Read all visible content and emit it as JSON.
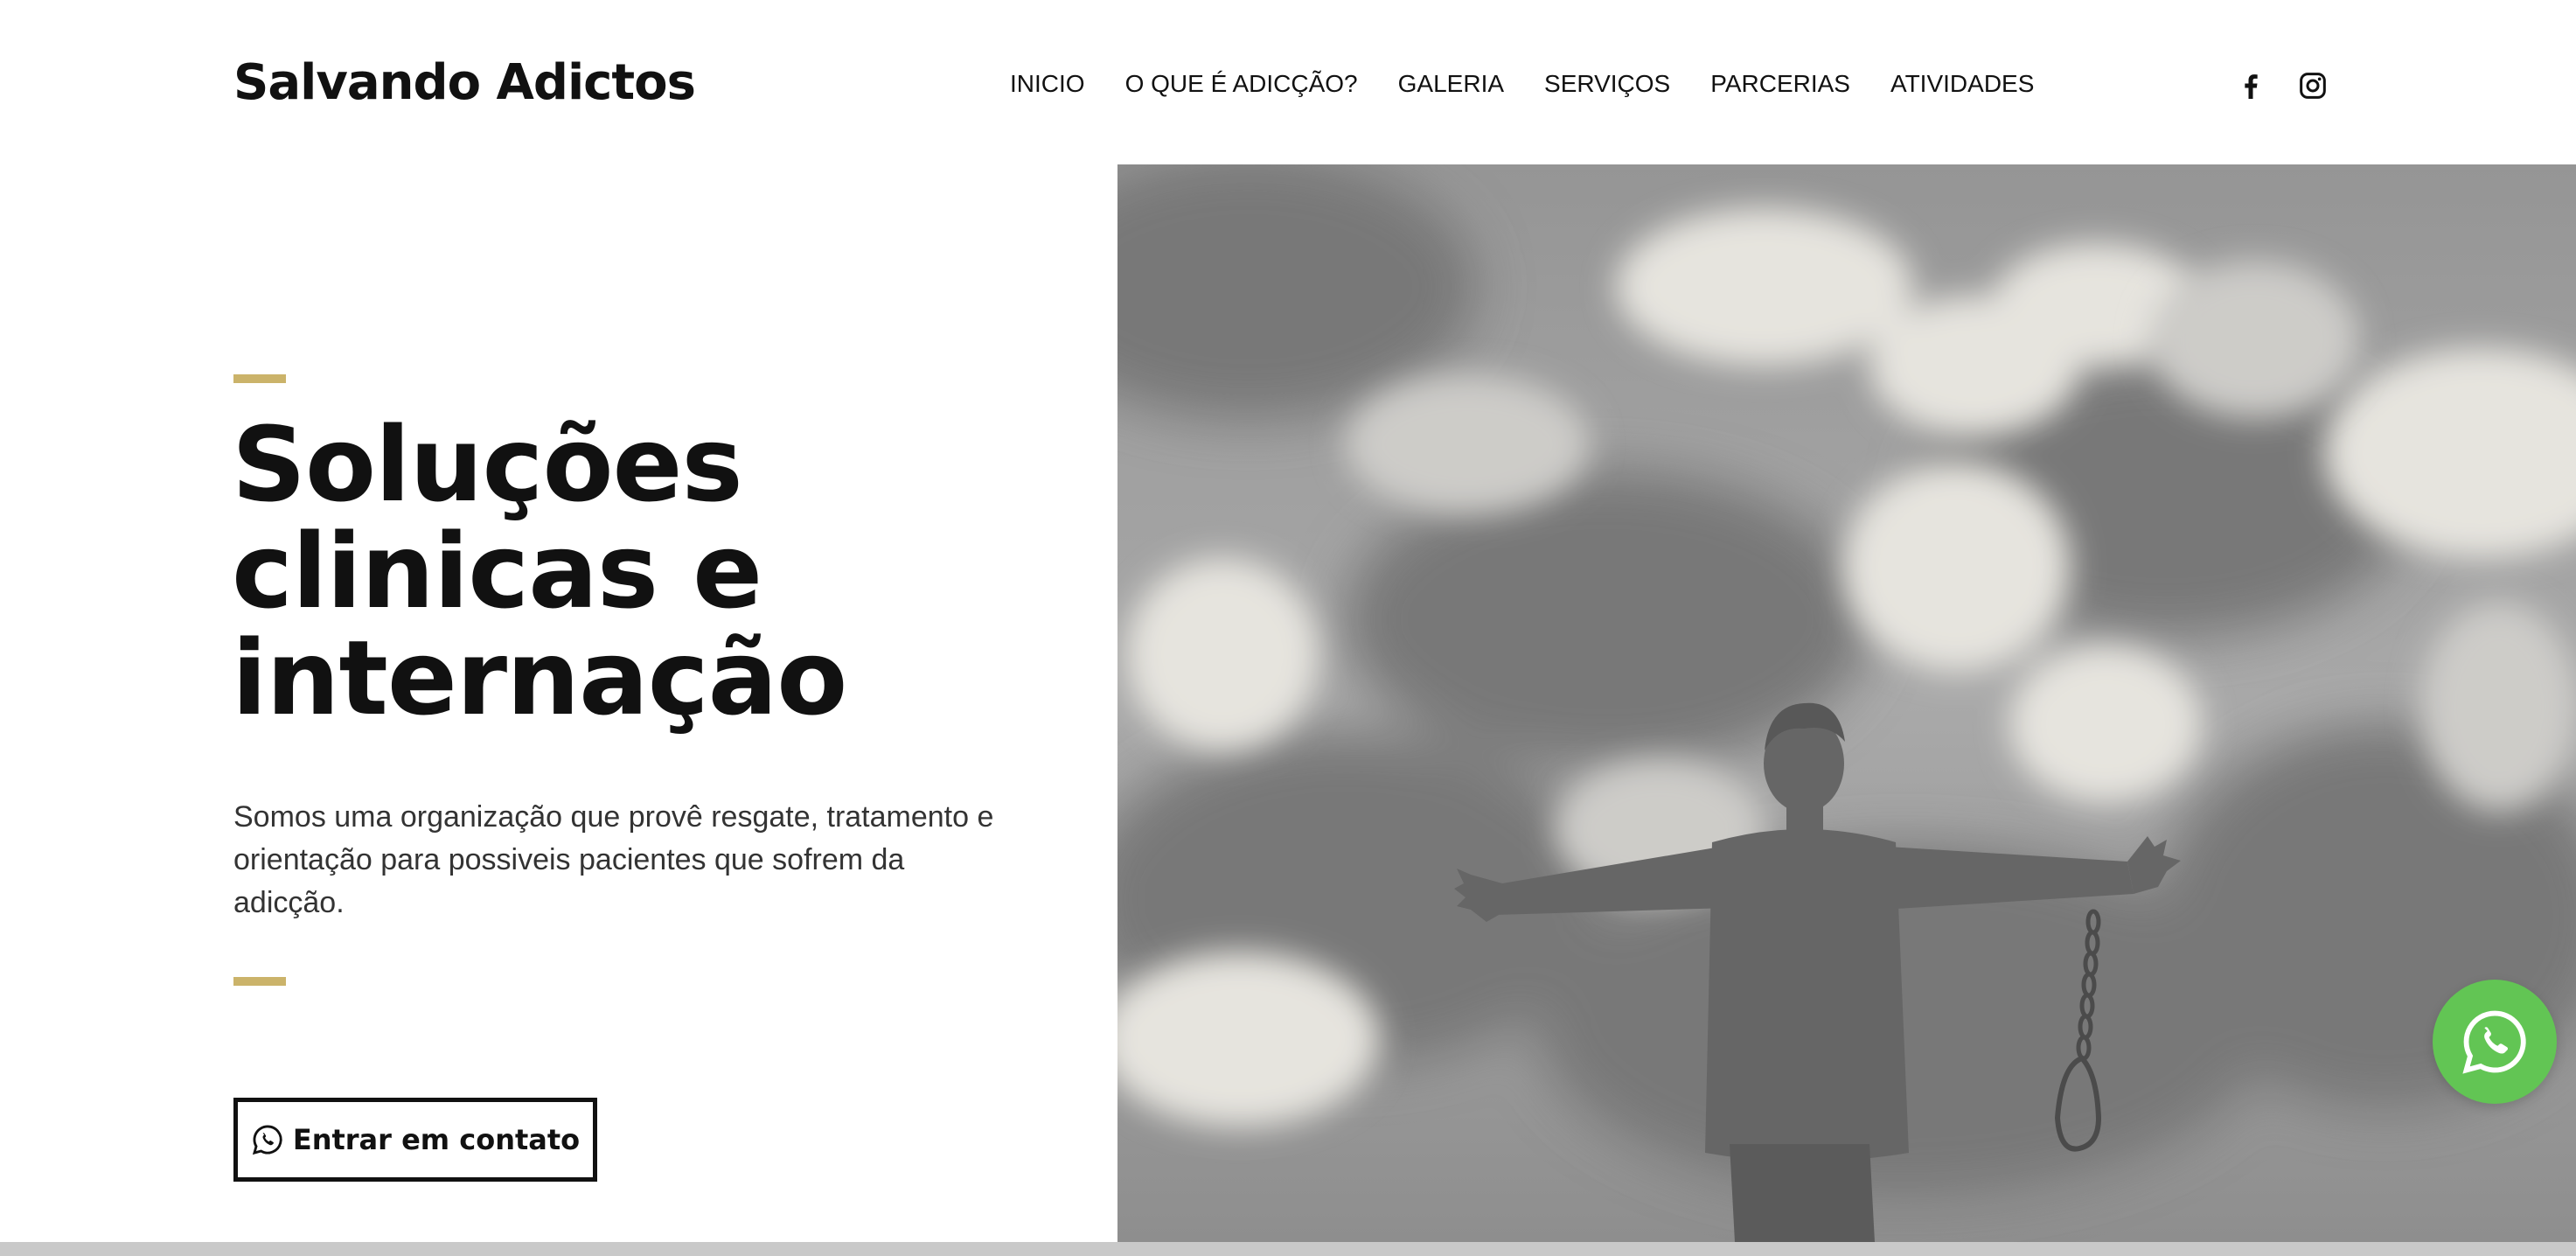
{
  "header": {
    "brand": "Salvando Adictos",
    "nav": [
      {
        "label": "INICIO"
      },
      {
        "label": "O QUE É ADICÇÃO?"
      },
      {
        "label": "GALERIA"
      },
      {
        "label": "SERVIÇOS"
      },
      {
        "label": "PARCERIAS"
      },
      {
        "label": "ATIVIDADES"
      }
    ],
    "social": [
      "facebook-icon",
      "instagram-icon"
    ]
  },
  "hero": {
    "headline": [
      "Soluções",
      "clinicas e",
      "internação"
    ],
    "description": "Somos uma organização que provê resgate, tratamento e orientação para possiveis pacientes que sofrem da adicção.",
    "cta_label": "Entrar em contato",
    "cta_icon": "whatsapp-icon",
    "image": "person with open arms, broken chain, cloudy sky"
  },
  "floating_button": {
    "icon": "whatsapp-icon"
  },
  "colors": {
    "accent": "#cbb36a",
    "whatsapp_green": "#62c554",
    "text": "#111111"
  }
}
